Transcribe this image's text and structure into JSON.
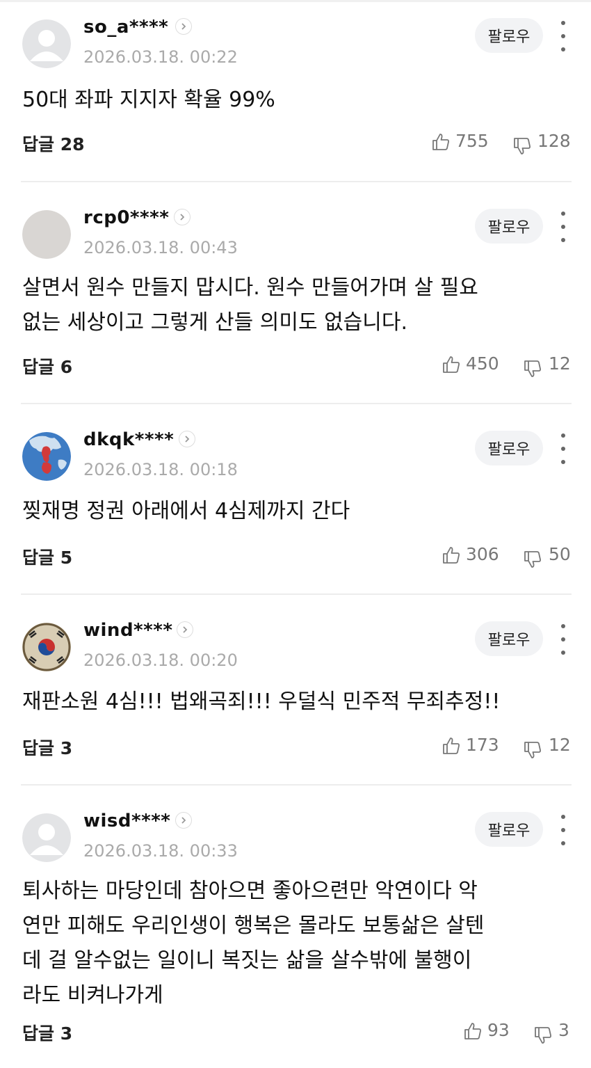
{
  "follow_label": "팔로우",
  "reply_prefix": "답글",
  "comments": [
    {
      "username": "so_a****",
      "date": "2026.03.18. 00:22",
      "text_lines": [
        "50대 좌파 지지자 확율 99%"
      ],
      "replies": "28",
      "likes": "755",
      "dislikes": "128",
      "avatar": "default-avatar"
    },
    {
      "username": "rcp0****",
      "date": "2026.03.18. 00:43",
      "text_lines": [
        "살면서 원수 만들지 맙시다. 원수 만들어가며 살 필요",
        "없는 세상이고 그렇게 산들 의미도 없습니다."
      ],
      "replies": "6",
      "likes": "450",
      "dislikes": "12",
      "avatar": "blank-gray-avatar"
    },
    {
      "username": "dkqk****",
      "date": "2026.03.18. 00:18",
      "text_lines": [
        "찢재명 정권 아래에서 4심제까지 간다"
      ],
      "replies": "5",
      "likes": "306",
      "dislikes": "50",
      "avatar": "korea-map-avatar"
    },
    {
      "username": "wind****",
      "date": "2026.03.18. 00:20",
      "text_lines": [
        "재판소원 4심!!! 법왜곡죄!!! 우덜식 민주적 무죄추정!!"
      ],
      "replies": "3",
      "likes": "173",
      "dislikes": "12",
      "avatar": "taegukgi-avatar"
    },
    {
      "username": "wisd****",
      "date": "2026.03.18. 00:33",
      "text_lines": [
        "퇴사하는 마당인데 참아으면 좋아으련만 악연이다 악",
        "연만 피해도 우리인생이 행복은 몰라도 보통삶은 살텐",
        "데 걸 알수없는 일이니 복짓는 삶을 살수밖에 불행이",
        "라도 비켜나가게"
      ],
      "replies": "3",
      "likes": "93",
      "dislikes": "3",
      "avatar": "default-avatar"
    }
  ],
  "colors": {
    "username": "#111111",
    "date": "#aaaaaa",
    "follow_bg": "#f2f3f5",
    "counts": "#777777"
  }
}
